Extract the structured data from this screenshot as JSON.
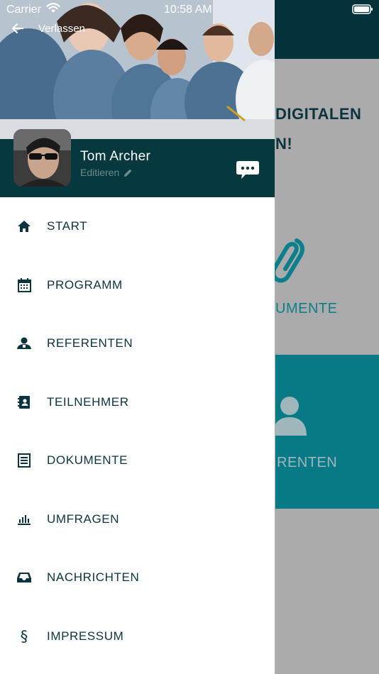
{
  "status_bar": {
    "carrier": "Carrier",
    "time": "10:58 AM"
  },
  "header": {
    "back_label": "Verlassen",
    "user_name": "Tom Archer",
    "edit_label": "Editieren"
  },
  "menu": {
    "items": [
      {
        "label": "START",
        "icon": "home-icon"
      },
      {
        "label": "PROGRAMM",
        "icon": "calendar-icon"
      },
      {
        "label": "REFERENTEN",
        "icon": "speaker-icon"
      },
      {
        "label": "TEILNEHMER",
        "icon": "contacts-book-icon"
      },
      {
        "label": "DOKUMENTE",
        "icon": "document-icon"
      },
      {
        "label": "UMFRAGEN",
        "icon": "bar-chart-icon"
      },
      {
        "label": "NACHRICHTEN",
        "icon": "inbox-icon"
      },
      {
        "label": "IMPRESSUM",
        "icon": "section-sign-icon"
      }
    ]
  },
  "background": {
    "heading_line1": "DIGITALEN",
    "heading_line2": "N!",
    "docs_tile_label": "UMENTE",
    "ref_tile_label": "RENTEN"
  },
  "colors": {
    "header_dark": "#06393f",
    "text_dark": "#0b3440",
    "teal": "#077a86",
    "overlay_gray": "#ababab"
  }
}
